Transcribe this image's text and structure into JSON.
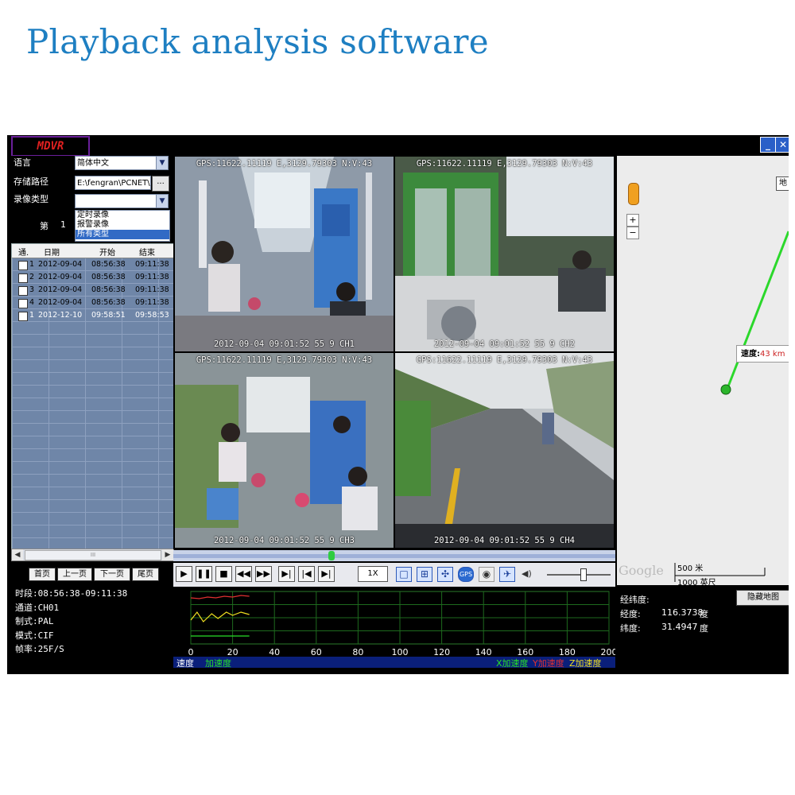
{
  "page": {
    "heading": "Playback analysis software"
  },
  "app": {
    "logo": "MDVR",
    "minimize_icon": "minimize-icon",
    "close_icon": "close-icon"
  },
  "settings": {
    "language_label": "语言",
    "language_value": "简体中文",
    "storage_label": "存储路径",
    "storage_value": "E:\\fengran\\PCNET\\(",
    "browse_label": "...",
    "record_type_label": "录像类型",
    "record_type_value": "",
    "page_label": "第",
    "page_number": "1",
    "record_type_options": [
      "定时录像",
      "报警录像",
      "所有类型"
    ],
    "record_type_selected": "所有类型"
  },
  "table": {
    "headers": [
      "通.",
      "日期",
      "开始",
      "结束"
    ],
    "rows": [
      {
        "ch": "1",
        "date": "2012-09-04",
        "start": "08:56:38",
        "end": "09:11:38"
      },
      {
        "ch": "2",
        "date": "2012-09-04",
        "start": "08:56:38",
        "end": "09:11:38"
      },
      {
        "ch": "3",
        "date": "2012-09-04",
        "start": "08:56:38",
        "end": "09:11:38"
      },
      {
        "ch": "4",
        "date": "2012-09-04",
        "start": "08:56:38",
        "end": "09:11:38"
      },
      {
        "ch": "1",
        "date": "2012-12-10",
        "start": "09:58:51",
        "end": "09:58:53"
      }
    ],
    "scroll_thumb_label": "III"
  },
  "pager": {
    "first": "首页",
    "prev": "上一页",
    "next": "下一页",
    "last": "尾页"
  },
  "info": {
    "period": "时段:08:56:38-09:11:38",
    "channel": "通道:CH01",
    "standard": "制式:PAL",
    "mode": "模式:CIF",
    "framerate": "帧率:25F/S"
  },
  "cameras": [
    {
      "gps": "GPS:11622.11119 E,3129.79303 N:V:43",
      "stamp": "2012-09-04 09:01:52 55 9 CH1",
      "border": "#d0408a"
    },
    {
      "gps": "GPS:11622.11119 E,3129.79303 N:V:43",
      "stamp": "2012-09-04 09:01:52 55 9 CH2",
      "border": "#3a5ad8"
    },
    {
      "gps": "GPS:11622.11119 E,3129.79303 N:V:43",
      "stamp": "2012-09-04 09:01:52 55 9 CH3",
      "border": "#3a5ad8"
    },
    {
      "gps": "GPS:11622.11119 E,3129.79303 N:V:43",
      "stamp": "2012-09-04 09:01:52 55 9 CH4",
      "border": "#3a5ad8"
    }
  ],
  "playback": {
    "speed": "1X",
    "position": 0.35,
    "volume": 0.55,
    "buttons": [
      "play-icon",
      "pause-icon",
      "stop-icon",
      "rewind-icon",
      "fast-forward-icon",
      "step-forward-icon",
      "skip-start-icon",
      "skip-end-icon"
    ]
  },
  "chart_data": {
    "type": "line",
    "x_ticks": [
      "0",
      "20",
      "40",
      "60",
      "80",
      "100",
      "120",
      "140",
      "160",
      "180",
      "200"
    ],
    "xlim": [
      0,
      200
    ],
    "speed_label": "速度",
    "accel_label": "加速度",
    "x_accel_label": "X加速度",
    "y_accel_label": "Y加速度",
    "z_accel_label": "Z加速度",
    "series_colors": {
      "x": "#28e028",
      "y": "#e03030",
      "z": "#f0e020"
    },
    "grid": true
  },
  "map": {
    "speed_label": "速度:",
    "speed_value": "43 km",
    "scale_metric": "500 米",
    "scale_imperial": "1000 英尺",
    "google_label": "Google",
    "person_icon": "pegman-icon",
    "zoom_in": "+",
    "zoom_out": "−",
    "top_label": "地"
  },
  "map_info": {
    "latlon_label": "经纬度:",
    "lon_label": "经度:",
    "lon_value": "116.3738",
    "lon_unit": "度",
    "lat_label": "纬度:",
    "lat_value": "31.4947",
    "lat_unit": "度",
    "hide_map": "隐藏地图"
  }
}
